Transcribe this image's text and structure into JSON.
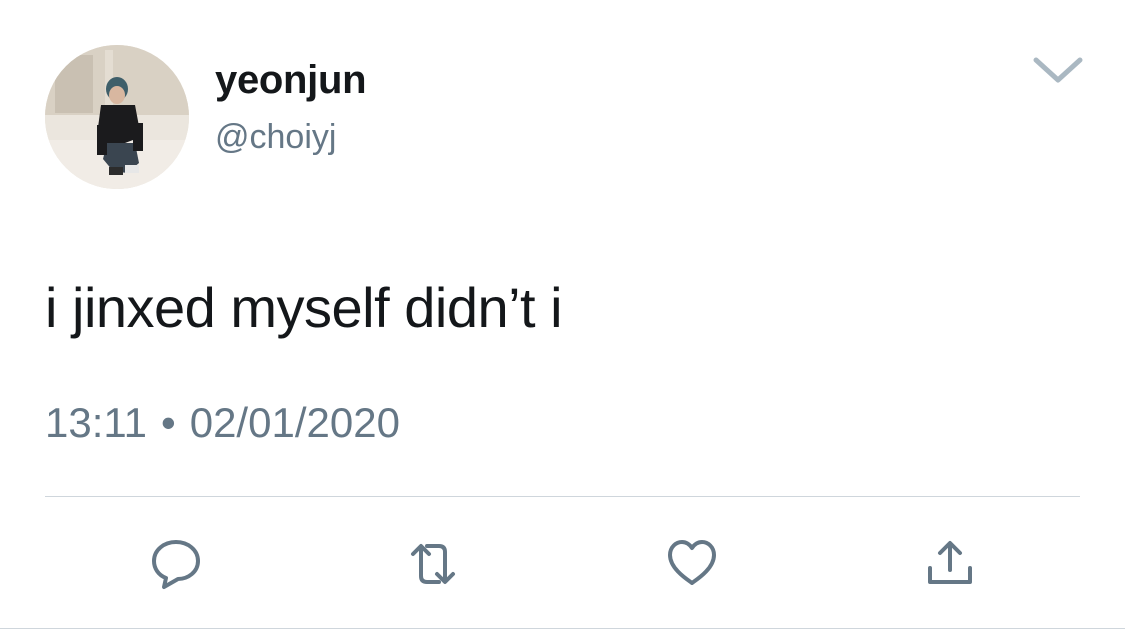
{
  "tweet": {
    "author": {
      "display_name": "yeonjun",
      "handle": "@choiyj",
      "avatar_icon": "user-photo-avatar"
    },
    "text": "i jinxed myself didn’t i",
    "time": "13:11",
    "separator": "•",
    "date": "02/01/2020"
  },
  "actions": {
    "reply_icon": "reply-bubble-icon",
    "retweet_icon": "retweet-icon",
    "like_icon": "heart-icon",
    "share_icon": "share-icon",
    "more_icon": "chevron-down-icon"
  },
  "colors": {
    "text": "#14171a",
    "secondary": "#657786",
    "icon": "#657786",
    "divider": "#cfd6dc"
  }
}
